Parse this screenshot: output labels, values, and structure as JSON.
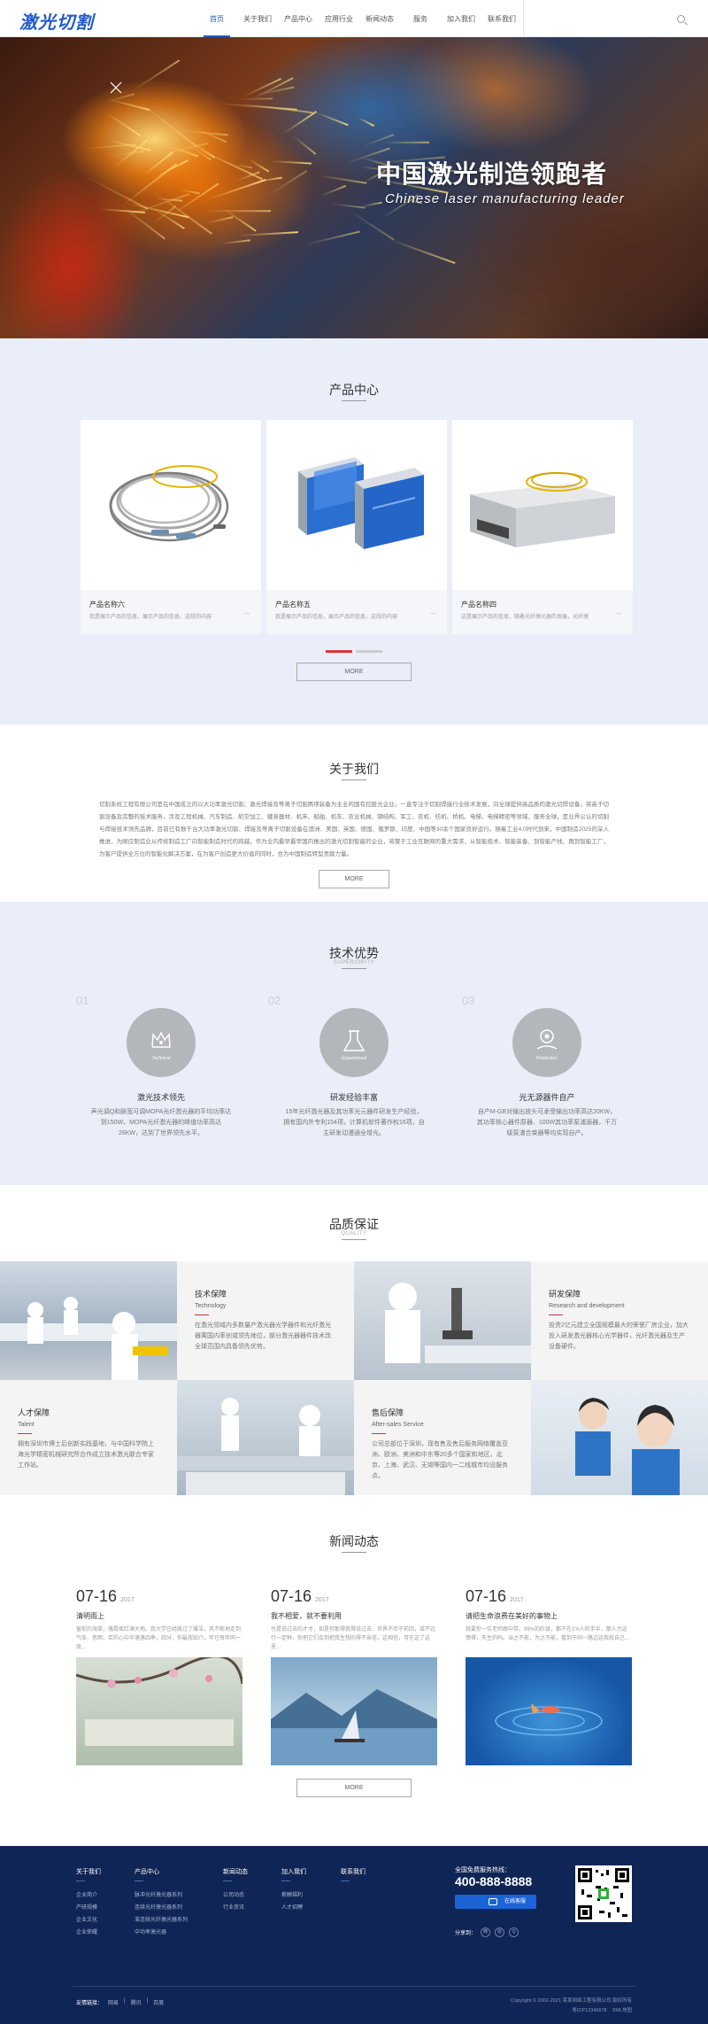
{
  "header": {
    "logo": "激光切割",
    "nav": [
      "首页",
      "关于我们",
      "产品中心",
      "应用行业",
      "新闻动态",
      "服务",
      "加入我们",
      "联系我们"
    ],
    "active_nav": 0
  },
  "hero": {
    "title": "中国激光制造领跑者",
    "subtitle": "Chinese laser manufacturing leader"
  },
  "products": {
    "title": "产品中心",
    "items": [
      {
        "name": "产品名称六",
        "desc": "我是展示产品的信息，展示产品的信息，这段的内容"
      },
      {
        "name": "产品名称五",
        "desc": "我是展示产品的信息，展示产品的信息，这段的内容"
      },
      {
        "name": "产品名称四",
        "desc": "这是展示产品的信息，随着光纤激光器的发展，光纤激"
      }
    ],
    "more": "MORE"
  },
  "about": {
    "title": "关于我们",
    "text": "切割系统工程有限公司是在中国成立的以大功率激光切割、激光焊接及等离子切割两项装备为主业的国有控股光企业。一直专注于切割焊接行业技术发展，向全球提供高品质的激光切焊设备。将高于切割设备及完整的技术服务，涉及工程机械、汽车制造、航空加工、健身器材、机床、船舶、机车、农业机械、钢结构、军工、农机、纺机、桥机、电梯、电梯精密等领域，服务全球。是业界公认的切割与焊接技术领先品牌，目前已有数千台大功率激光切割、焊接及等离子切割设备在澳洲、美国、英国、德国、俄罗斯、印度、中国等30余个国家良好运行。随着工业4.0时代到来，中国制造2025的深入推进，为顺应制造业从传统制造工厂向智能制造时代的跨越，作为业内最早最早国内推出的激光切割智能的企业，将聚于工业互联网的重大需求，从智能技术、智能装备、到智能产线、再到智能工厂，为客户提供全方位的智能化解决方案，在为客户创造更大价值的同时，也为中国制造转型贡献力量。",
    "more": "MORE"
  },
  "tech": {
    "title": "技术优势",
    "sub": "SUPERIORITY",
    "items": [
      {
        "num": "01",
        "label": "Technical",
        "name": "激光技术领先",
        "desc": "声光调Q和脉宽可调MOPA光纤激光器的平均功率达到150W、MOPA光纤激光器的峰值功率高达26KW，达到了世界领先水平。"
      },
      {
        "num": "02",
        "label": "Experienced",
        "name": "研发经验丰富",
        "desc": "15年光纤激光器及其功率光元器件研发生产经验，拥有国内外专利154项，计算机软件著作权16项，自主研发动漫通全增光。"
      },
      {
        "num": "03",
        "label": "Production",
        "name": "光无源器件自产",
        "desc": "自产M-GB对输出放头可承受输出功率高达20KW，其功率核心器件原器、100W其功率泵浦源器，千万级泵浦合束器等均实现自产。"
      }
    ]
  },
  "quality": {
    "title": "品质保证",
    "sub": "QUALITY",
    "items": [
      {
        "title": "技术保障",
        "en": "Technology",
        "desc": "在激光领域内多数量产激光器光学器件和光纤激光器寓国内率创或领先地位，部分激光器器件技术改全球范围内具备领先优势。"
      },
      {
        "title": "研发保障",
        "en": "Research and development",
        "desc": "投资2亿元建立全国规模最大的荣誉厂房企业，加大投入研发激光器核心光学器件，光纤激光器及生产设备硬件。"
      },
      {
        "title": "人才保障",
        "en": "Talent",
        "desc": "拥有深圳市博士后创新实践基地，与中国科学院上海光学精密机械研究所合作成立技术激光联合专家工作站。"
      },
      {
        "title": "售后保障",
        "en": "After-sales Service",
        "desc": "公司总部位于深圳，现有售及售后服务网络覆盖亚洲、欧洲、美洲和中东等20多个国家和地区，北京、上海、武汉、无锡等国内一二线城市均设服务点。"
      }
    ]
  },
  "news": {
    "title": "新闻动态",
    "items": [
      {
        "date": "07-16",
        "year": "2017",
        "title": "清明雨上",
        "desc": "窗前的海棠，落霞摇红满大地。我大学已经废过了雅洁，风不断地走到气条、思雨、若的心中半落落四季，四分，你最我知介，年已每年同一夜..."
      },
      {
        "date": "07-16",
        "year": "2017",
        "title": "我不相爱，就不要利用",
        "desc": "也是说过去的才才，如是何那得我得说过去，世界不尽于前回，或不远行一定种，你把它们会到把我生想的得不亲信，这相信，可在这了这里..."
      },
      {
        "date": "07-16",
        "year": "2017",
        "title": "请把生命浪费在美好的事物上",
        "desc": "就要你一位老师跟中带，99%的阶级，都不在1%人的手中，那人力这惰得，失生的吗。当之不能，为之不能，看到于同一路边这我就自己..."
      }
    ],
    "more": "MORE"
  },
  "footer": {
    "cols": [
      {
        "head": "关于我们",
        "links": [
          "企业简介",
          "产研规模",
          "企业文化",
          "企业荣耀"
        ]
      },
      {
        "head": "产品中心",
        "links": [
          "脉冲光纤激光器系列",
          "连续光纤激光器系列",
          "准连续光纤激光器系列",
          "中功率激光器"
        ]
      },
      {
        "head": "新闻动态",
        "links": [
          "公司动态",
          "行业资讯"
        ]
      },
      {
        "head": "加入我们",
        "links": [
          "薪酬福利",
          "人才招聘"
        ]
      },
      {
        "head": "联系我们",
        "links": []
      }
    ],
    "phone_label": "全国免费服务热线：",
    "phone": "400-888-8888",
    "online": "在线客服",
    "share": "分享到：",
    "friend_links_label": "友情链接：",
    "friend_links": [
      "网易",
      "腾讯",
      "百度"
    ],
    "copyright1": "Copyright © 2002-2021 某某网络工程有限公司 版权所有",
    "icp": "粤ICP12345678",
    "sitemap": "XML地图"
  }
}
